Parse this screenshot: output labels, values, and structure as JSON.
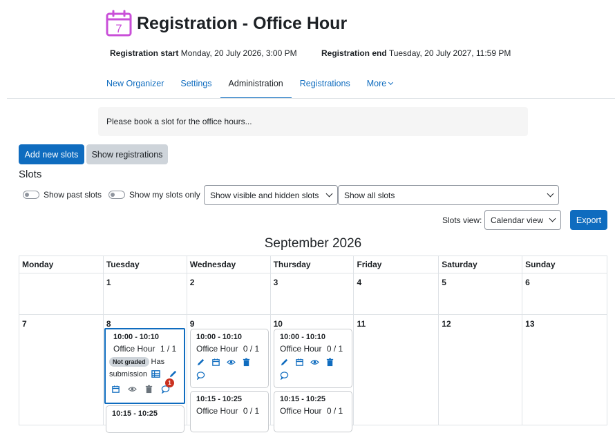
{
  "header": {
    "title": "Registration - Office Hour",
    "icon_day": "7",
    "reg_start_label": "Registration start",
    "reg_start_value": "Monday, 20 July 2026, 3:00 PM",
    "reg_end_label": "Registration end",
    "reg_end_value": "Tuesday, 20 July 2027, 11:59 PM",
    "accent_color": "#c94fd8"
  },
  "nav": {
    "items": [
      "New Organizer",
      "Settings",
      "Administration",
      "Registrations",
      "More"
    ],
    "active": "Administration"
  },
  "intro_text": "Please book a slot for the office hours...",
  "actions": {
    "add_slots": "Add new slots",
    "show_registrations": "Show registrations"
  },
  "slots": {
    "heading": "Slots",
    "show_past": "Show past slots",
    "show_mine": "Show my slots only",
    "visibility_select": "Show visible and hidden slots",
    "filter_select": "Show all slots",
    "view_label": "Slots view:",
    "view_select": "Calendar view",
    "export": "Export"
  },
  "calendar": {
    "month": "September 2026",
    "weekdays": [
      "Monday",
      "Tuesday",
      "Wednesday",
      "Thursday",
      "Friday",
      "Saturday",
      "Sunday"
    ],
    "week1": [
      "",
      "1",
      "2",
      "3",
      "4",
      "5",
      "6"
    ],
    "week2": [
      "7",
      "8",
      "9",
      "10",
      "11",
      "12",
      "13"
    ],
    "tue_slot1": {
      "time": "10:00 - 10:10",
      "name": "Office Hour",
      "count": "1 / 1",
      "badge": "Not graded",
      "status_a": "Has",
      "status_b": "submission",
      "comments": "1"
    },
    "tue_slot2": {
      "time": "10:15 - 10:25"
    },
    "wed_slot1": {
      "time": "10:00 - 10:10",
      "name": "Office Hour",
      "count": "0 / 1"
    },
    "wed_slot2": {
      "time": "10:15 - 10:25",
      "name": "Office Hour",
      "count": "0 / 1"
    },
    "thu_slot1": {
      "time": "10:00 - 10:10",
      "name": "Office Hour",
      "count": "0 / 1"
    },
    "thu_slot2": {
      "time": "10:15 - 10:25",
      "name": "Office Hour",
      "count": "0 / 1"
    }
  },
  "colors": {
    "primary": "#0f6cbf",
    "danger": "#ca3120"
  }
}
